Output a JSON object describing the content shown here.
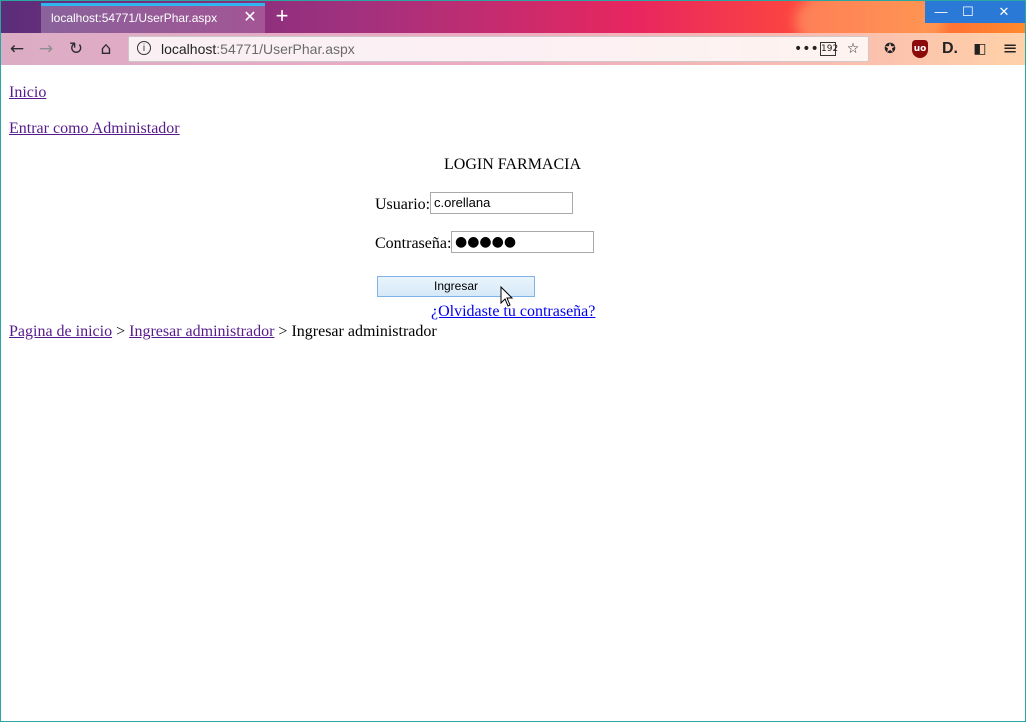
{
  "browser": {
    "tab_title": "localhost:54771/UserPhar.aspx",
    "tab_close": "✕",
    "new_tab": "+",
    "url_host": "localhost",
    "url_rest": ":54771/UserPhar.aspx",
    "window_controls": {
      "minimize": "—",
      "maximize": "☐",
      "close": "✕"
    },
    "nav": {
      "back": "←",
      "forward": "→",
      "reload": "↻",
      "home": "⌂"
    },
    "url_tools": {
      "more": "•••",
      "reader": "192",
      "bookmark": "☆"
    },
    "extensions": {
      "pocket": "✪",
      "ublock": "uo",
      "dashlane": "D.",
      "sidebar": "◧",
      "menu": "≡"
    }
  },
  "page": {
    "links": {
      "inicio": "Inicio",
      "admin": "Entrar como Administador"
    },
    "title": "LOGIN FARMACIA",
    "form": {
      "usuario_label": "Usuario:",
      "usuario_value": "c.orellana",
      "password_label": "Contraseña:",
      "password_value": "●●●●●",
      "submit_label": "Ingresar",
      "forgot_link": "¿Olvidaste tu contraseña?"
    },
    "breadcrumb": {
      "home": "Pagina de inicio",
      "sep1": " > ",
      "parent": "Ingresar administrador",
      "sep2": " > ",
      "current": "Ingresar administrador"
    }
  }
}
